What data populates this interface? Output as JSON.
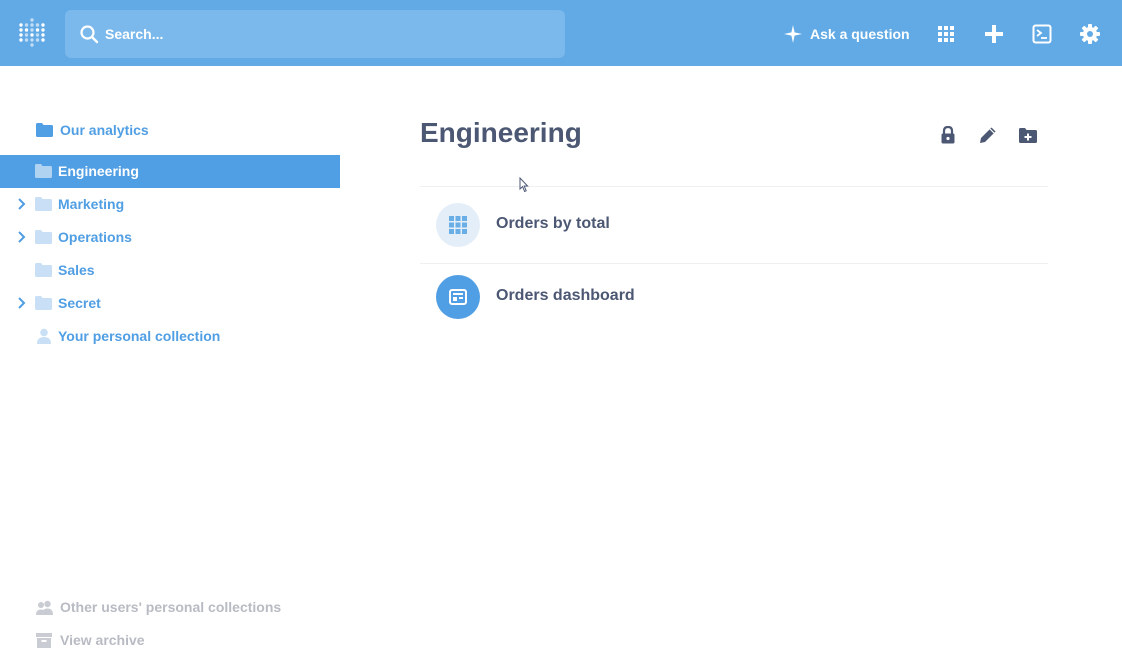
{
  "header": {
    "search_placeholder": "Search...",
    "ask_label": "Ask a question",
    "icons": [
      "grid-icon",
      "plus-icon",
      "terminal-icon",
      "gear-icon"
    ],
    "accent": "#509ee3",
    "bar_color": "#62aae5"
  },
  "sidebar": {
    "root": {
      "label": "Our analytics",
      "icon": "folder-icon"
    },
    "items": [
      {
        "label": "Engineering",
        "icon": "folder-icon",
        "active": true,
        "expandable": false
      },
      {
        "label": "Marketing",
        "icon": "folder-icon",
        "active": false,
        "expandable": true
      },
      {
        "label": "Operations",
        "icon": "folder-icon",
        "active": false,
        "expandable": true
      },
      {
        "label": "Sales",
        "icon": "folder-icon",
        "active": false,
        "expandable": false
      },
      {
        "label": "Secret",
        "icon": "folder-icon",
        "active": false,
        "expandable": true
      },
      {
        "label": "Your personal collection",
        "icon": "person-icon",
        "active": false,
        "expandable": false
      }
    ],
    "footer": {
      "other_users": "Other users' personal collections",
      "archive": "View archive"
    }
  },
  "main": {
    "title": "Engineering",
    "actions": [
      "lock-icon",
      "pencil-icon",
      "new-collection-icon"
    ],
    "items": [
      {
        "name": "Orders by total",
        "type": "question",
        "icon": "table-grid-icon"
      },
      {
        "name": "Orders dashboard",
        "type": "dashboard",
        "icon": "dashboard-icon"
      }
    ]
  }
}
